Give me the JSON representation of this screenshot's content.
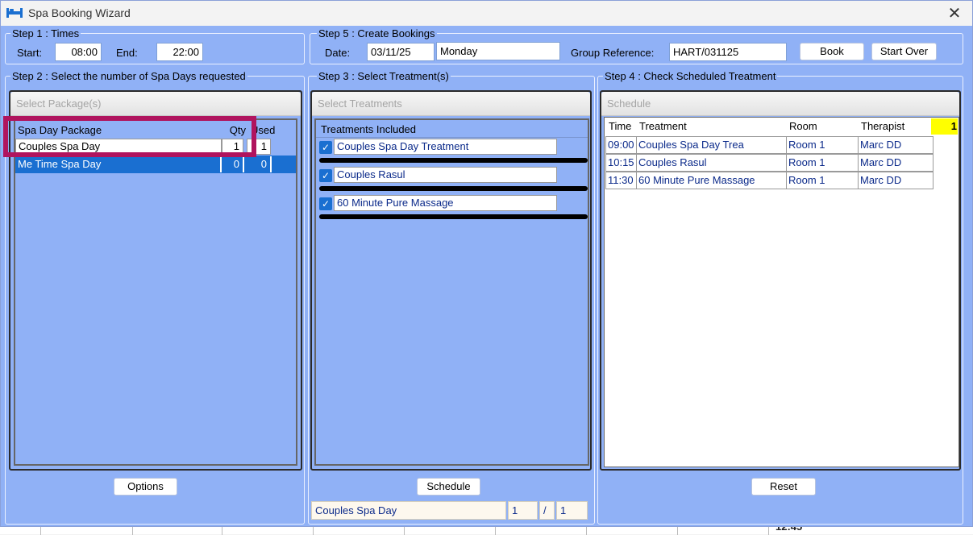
{
  "window": {
    "title": "Spa Booking Wizard",
    "close_glyph": "✕",
    "background_color": "#90b1f6"
  },
  "step1": {
    "label": "Step 1 : Times",
    "start_label": "Start:",
    "start_value": "08:00",
    "end_label": "End:",
    "end_value": "22:00"
  },
  "step5": {
    "label": "Step 5 : Create Bookings",
    "date_label": "Date:",
    "date_value": "03/11/25",
    "day_value": "Monday",
    "group_ref_label": "Group Reference:",
    "group_ref_value": "HART/031125",
    "book_label": "Book",
    "start_over_label": "Start Over"
  },
  "step2": {
    "label": "Step 2 : Select the number of Spa Days requested",
    "panel_title": "Select Package(s)",
    "headers": {
      "package": "Spa Day Package",
      "qty": "Qty",
      "used": "Used"
    },
    "rows": [
      {
        "name": "Couples Spa Day",
        "qty": "1",
        "used": "1",
        "selected": false
      },
      {
        "name": "Me Time Spa Day",
        "qty": "0",
        "used": "0",
        "selected": true
      }
    ],
    "options_label": "Options",
    "highlight_color": "#b0145e"
  },
  "step3": {
    "label": "Step 3 : Select Treatment(s)",
    "panel_title": "Select Treatments",
    "header": "Treatments Included",
    "treatments": [
      {
        "name": "Couples Spa Day Treatment",
        "checked": true
      },
      {
        "name": "Couples Rasul",
        "checked": true
      },
      {
        "name": "60 Minute Pure Massage",
        "checked": true
      }
    ],
    "check_glyph": "✓",
    "schedule_label": "Schedule",
    "footer": {
      "package": "Couples Spa Day",
      "count": "1",
      "separator": "/",
      "total": "1"
    }
  },
  "step4": {
    "label": "Step 4 : Check Scheduled Treatment",
    "panel_title": "Schedule",
    "headers": {
      "time": "Time",
      "treatment": "Treatment",
      "room": "Room",
      "therapist": "Therapist",
      "count": "1"
    },
    "rows": [
      {
        "time": "09:00",
        "treatment": "Couples Spa Day Trea",
        "room": "Room 1",
        "therapist": "Marc DD"
      },
      {
        "time": "10:15",
        "treatment": "Couples Rasul",
        "room": "Room 1",
        "therapist": "Marc DD"
      },
      {
        "time": "11:30",
        "treatment": "60 Minute Pure Massage",
        "room": "Room 1",
        "therapist": "Marc DD"
      }
    ],
    "reset_label": "Reset"
  },
  "background_app": {
    "partial_text": "12:45"
  }
}
